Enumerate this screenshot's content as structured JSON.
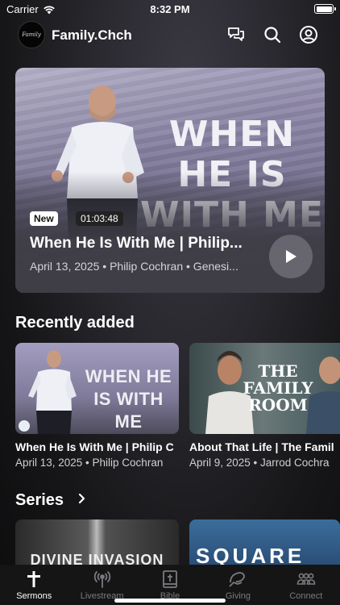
{
  "status_bar": {
    "carrier": "Carrier",
    "time": "8:32 PM"
  },
  "header": {
    "title": "Family.Chch",
    "logo_text": "Family"
  },
  "hero": {
    "artwork_title": "WHEN HE IS WITH ME",
    "badge_new": "New",
    "duration": "01:03:48",
    "title": "When He Is With Me | Philip...",
    "meta": "April 13, 2025 • Philip Cochran • Genesi..."
  },
  "sections": {
    "recently_added": "Recently added",
    "series": "Series"
  },
  "recent": [
    {
      "artwork": "WHEN HE IS WITH ME",
      "title": "When He Is With Me | Philip C",
      "meta": "April 13, 2025 • Philip Cochran"
    },
    {
      "artwork": "THE FAMILY ROOM",
      "title": "About That Life | The Famil",
      "meta": "April 9, 2025 • Jarrod Cochra"
    }
  ],
  "series": [
    {
      "artwork": "DIVINE INVASION"
    },
    {
      "artwork": "SQUARE UP"
    }
  ],
  "tabs": [
    {
      "label": "Sermons",
      "icon": "cross-icon",
      "active": true
    },
    {
      "label": "Livestream",
      "icon": "broadcast-icon",
      "active": false
    },
    {
      "label": "Bible",
      "icon": "bible-icon",
      "active": false
    },
    {
      "label": "Giving",
      "icon": "giving-icon",
      "active": false
    },
    {
      "label": "Connect",
      "icon": "people-icon",
      "active": false
    }
  ]
}
